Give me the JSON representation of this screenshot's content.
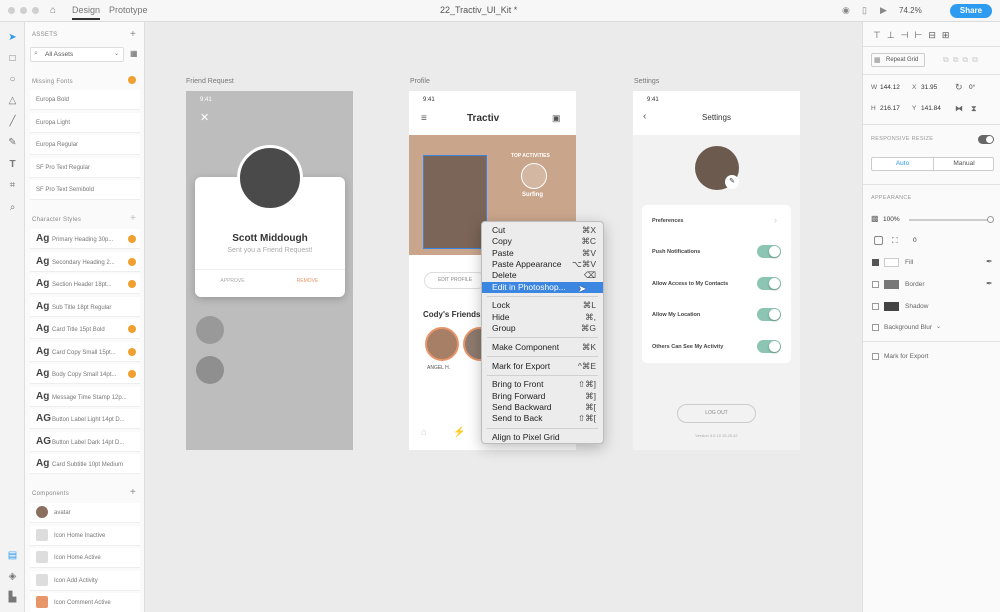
{
  "topbar": {
    "tab_design": "Design",
    "tab_prototype": "Prototype",
    "doc_title": "22_Tractiv_UI_Kit *",
    "zoom": "74.2%",
    "share": "Share"
  },
  "assets": {
    "header": "ASSETS",
    "filter": "All Assets",
    "missing_fonts": {
      "label": "Missing Fonts",
      "items": [
        "Europa Bold",
        "Europa Light",
        "Europa Regular",
        "SF Pro Text Regular",
        "SF Pro Text Semibold"
      ]
    },
    "char_styles": {
      "label": "Character Styles",
      "items": [
        {
          "glyph": "Ag",
          "label": "Primary Heading 30p..."
        },
        {
          "glyph": "Ag",
          "label": "Secondary Heading 2..."
        },
        {
          "glyph": "Ag",
          "label": "Section Header 18pt..."
        },
        {
          "glyph": "Ag",
          "label": "Sub Title 18pt Regular"
        },
        {
          "glyph": "Ag",
          "label": "Card Title 15pt Bold"
        },
        {
          "glyph": "Ag",
          "label": "Card Copy Small 15pt..."
        },
        {
          "glyph": "Ag",
          "label": "Body Copy Small 14pt..."
        },
        {
          "glyph": "Ag",
          "label": "Message Time Stamp 12p..."
        },
        {
          "glyph": "AG",
          "label": "Button Label Light 14pt D..."
        },
        {
          "glyph": "AG",
          "label": "Button Label Dark 14pt D..."
        },
        {
          "glyph": "Ag",
          "label": "Card Subtitle 10pt Medium"
        }
      ]
    },
    "components": {
      "label": "Components",
      "items": [
        "avatar",
        "Icon Home Inactive",
        "Icon Home Active",
        "Icon Add Activity",
        "Icon Comment Active"
      ]
    }
  },
  "artboards": {
    "friend": {
      "label": "Friend Request",
      "time": "9:41",
      "name": "Scott Middough",
      "subtitle": "Sent you a Friend Request!",
      "approve": "APPROVE",
      "remove": "REMOVE"
    },
    "profile": {
      "label": "Profile",
      "time": "9:41",
      "brand": "Tractiv",
      "top_activities": "TOP ACTIVITIES",
      "activity": "Surfing",
      "edit_profile": "EDIT PROFILE",
      "friends_title": "Cody's Friends",
      "friend_name": "ANGEL H."
    },
    "settings": {
      "label": "Settings",
      "time": "9:41",
      "title": "Settings",
      "preferences": "Preferences",
      "toggles": [
        "Push Notifications",
        "Allow Access to My Contacts",
        "Allow My Location",
        "Others Can See My Activity"
      ],
      "logout": "LOG OUT",
      "version": "Version 4.0.10 15.25.42"
    }
  },
  "context_menu": {
    "items": [
      {
        "label": "Cut",
        "key": "⌘X"
      },
      {
        "label": "Copy",
        "key": "⌘C"
      },
      {
        "label": "Paste",
        "key": "⌘V"
      },
      {
        "label": "Paste Appearance",
        "key": "⌥⌘V"
      },
      {
        "label": "Delete",
        "key": "⌫"
      },
      {
        "label": "Edit in Photoshop...",
        "key": ""
      },
      {
        "label": "Lock",
        "key": "⌘L"
      },
      {
        "label": "Hide",
        "key": "⌘,"
      },
      {
        "label": "Group",
        "key": "⌘G"
      },
      {
        "label": "Make Component",
        "key": "⌘K"
      },
      {
        "label": "Mark for Export",
        "key": "^⌘E"
      },
      {
        "label": "Bring to Front",
        "key": "⇧⌘]"
      },
      {
        "label": "Bring Forward",
        "key": "⌘]"
      },
      {
        "label": "Send Backward",
        "key": "⌘["
      },
      {
        "label": "Send to Back",
        "key": "⇧⌘["
      },
      {
        "label": "Align to Pixel Grid",
        "key": ""
      }
    ]
  },
  "props": {
    "repeat_grid": "Repeat Grid",
    "w_label": "W",
    "w": "144.12",
    "x_label": "X",
    "x": "31.95",
    "rot": "0°",
    "h_label": "H",
    "h": "216.17",
    "y_label": "Y",
    "y": "141.84",
    "responsive": "RESPONSIVE RESIZE",
    "auto": "Auto",
    "manual": "Manual",
    "appearance": "APPEARANCE",
    "opacity": "100%",
    "radius": "0",
    "fill": "Fill",
    "border": "Border",
    "shadow": "Shadow",
    "blur": "Background Blur",
    "export": "Mark for Export"
  },
  "colors": {
    "accent": "#2d9bf0",
    "toggle": "#8cc5b4",
    "brand_orange": "#e8956a",
    "selected": "#3b86e0"
  }
}
